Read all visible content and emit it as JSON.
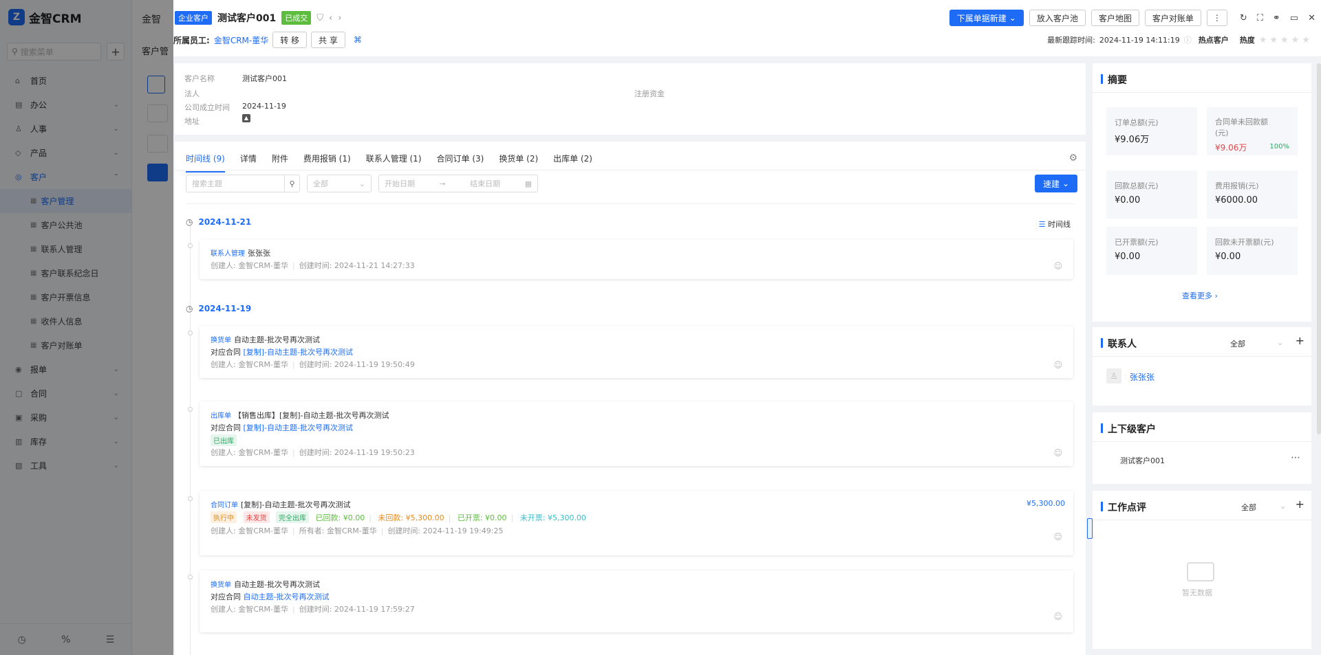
{
  "app": {
    "name": "金智CRM",
    "under_title": "金智",
    "under_subtitle": "客户管"
  },
  "sidebar": {
    "search_placeholder": "搜索菜单",
    "items": [
      {
        "icon": "home-icon",
        "label": "首页"
      },
      {
        "icon": "office-icon",
        "label": "办公"
      },
      {
        "icon": "people-icon",
        "label": "人事"
      },
      {
        "icon": "product-icon",
        "label": "产品"
      },
      {
        "icon": "customer-icon",
        "label": "客户"
      }
    ],
    "customer_sub": [
      {
        "label": "客户管理"
      },
      {
        "label": "客户公共池"
      },
      {
        "label": "联系人管理"
      },
      {
        "label": "客户联系纪念日"
      },
      {
        "label": "客户开票信息"
      },
      {
        "label": "收件人信息"
      },
      {
        "label": "客户对账单"
      }
    ],
    "items_after": [
      {
        "icon": "order-icon",
        "label": "报单"
      },
      {
        "icon": "contract-icon",
        "label": "合同"
      },
      {
        "icon": "purchase-icon",
        "label": "采购"
      },
      {
        "icon": "stock-icon",
        "label": "库存"
      },
      {
        "icon": "tool-icon",
        "label": "工具"
      }
    ]
  },
  "header": {
    "type_tag": "企业客户",
    "customer_name": "测试客户001",
    "status_tag": "已成交",
    "owner_label": "所属员工:",
    "owner_name": "金智CRM-董华",
    "transfer_btn": "转 移",
    "share_btn": "共 享",
    "new_btn": "下属单据新建",
    "pool_btn": "放入客户池",
    "map_btn": "客户地图",
    "statement_btn": "客户对账单",
    "last_follow_label": "最新跟踪时间:",
    "last_follow_time": "2024-11-19 14:11:19",
    "hot_label": "热点客户",
    "heat_label": "热度",
    "heat_stars": "★★★★★"
  },
  "info": {
    "name_label": "客户名称",
    "name_value": "测试客户001",
    "legal_label": "法人",
    "capital_label": "注册资金",
    "founded_label": "公司成立时间",
    "founded_value": "2024-11-19",
    "address_label": "地址"
  },
  "tabs": [
    {
      "label": "时间线 (9)"
    },
    {
      "label": "详情"
    },
    {
      "label": "附件"
    },
    {
      "label": "费用报销 (1)"
    },
    {
      "label": "联系人管理 (1)"
    },
    {
      "label": "合同订单 (3)"
    },
    {
      "label": "换货单 (2)"
    },
    {
      "label": "出库单 (2)"
    }
  ],
  "filters": {
    "search_placeholder": "搜索主题",
    "type_value": "全部",
    "start_placeholder": "开始日期",
    "end_placeholder": "结束日期",
    "quick_btn": "速建"
  },
  "timeline": {
    "toggle_label": "时间线",
    "date1": "2024-11-21",
    "date2": "2024-11-19",
    "cards": [
      {
        "type": "联系人管理",
        "title": "张张张",
        "creator": "创建人: 金智CRM-董华",
        "time": "创建时间: 2024-11-21 14:27:33"
      },
      {
        "type": "换货单",
        "title": "自动主题-批次号再次测试",
        "contract_label": "对应合同",
        "contract_link": "[复制]-自动主题-批次号再次测试",
        "creator": "创建人: 金智CRM-董华",
        "time": "创建时间: 2024-11-19 19:50:49"
      },
      {
        "type": "出库单",
        "title": "【销售出库】[复制]-自动主题-批次号再次测试",
        "contract_label": "对应合同",
        "contract_link": "[复制]-自动主题-批次号再次测试",
        "badge": "已出库",
        "creator": "创建人: 金智CRM-董华",
        "time": "创建时间: 2024-11-19 19:50:23"
      },
      {
        "type": "合同订单",
        "title": "[复制]-自动主题-批次号再次测试",
        "amount": "¥5,300.00",
        "badge1": "执行中",
        "badge2": "未发货",
        "badge3": "完全出库",
        "paid": "已回款: ¥0.00",
        "unpaid": "未回款: ¥5,300.00",
        "invoiced": "已开票: ¥0.00",
        "uninvoiced": "未开票: ¥5,300.00",
        "creator": "创建人: 金智CRM-董华",
        "owner": "所有者: 金智CRM-董华",
        "time": "创建时间: 2024-11-19 19:49:25"
      },
      {
        "type": "换货单",
        "title": "自动主题-批次号再次测试",
        "contract_label": "对应合同",
        "contract_link": "自动主题-批次号再次测试",
        "creator": "创建人: 金智CRM-董华",
        "time": "创建时间: 2024-11-19 17:59:27"
      }
    ]
  },
  "summary": {
    "title": "摘要",
    "stats": [
      {
        "label": "订单总额(元)",
        "value": "¥9.06万"
      },
      {
        "label": "合同单未回款额(元)",
        "value": "¥9.06万",
        "percent": "100%"
      },
      {
        "label": "回款总额(元)",
        "value": "¥0.00"
      },
      {
        "label": "费用报销(元)",
        "value": "¥6000.00"
      },
      {
        "label": "已开票额(元)",
        "value": "¥0.00"
      },
      {
        "label": "回款未开票额(元)",
        "value": "¥0.00"
      }
    ],
    "more": "查看更多"
  },
  "contacts": {
    "title": "联系人",
    "filter": "全部",
    "name": "张张张"
  },
  "hierarchy": {
    "title": "上下级客户",
    "name": "测试客户001"
  },
  "reviews": {
    "title": "工作点评",
    "filter": "全部",
    "empty": "暂无数据"
  },
  "colors": {
    "accent": "#1e6cf5",
    "success": "#5ebd3f",
    "danger": "#e04646"
  }
}
